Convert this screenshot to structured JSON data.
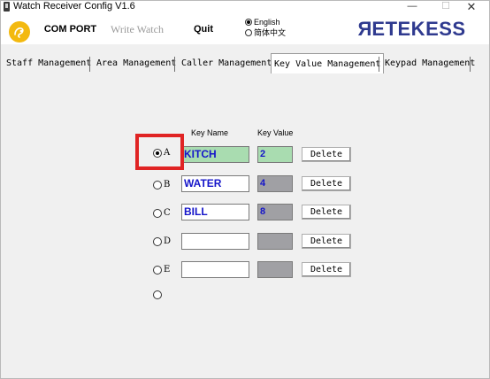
{
  "window": {
    "title": "Watch Receiver Config V1.6",
    "minimize_glyph": "—",
    "maximize_glyph": "☐",
    "close_glyph": "✕"
  },
  "toolbar": {
    "com_port_label": "COM PORT",
    "write_watch_label": "Write Watch",
    "quit_label": "Quit",
    "language": {
      "english_label": "English",
      "chinese_label": "简体中文",
      "selected": "English"
    },
    "brand_first": "R",
    "brand_rest": "ETEKESS"
  },
  "tabs": [
    {
      "label": "Staff Management",
      "active": false
    },
    {
      "label": "Area Management",
      "active": false
    },
    {
      "label": "Caller Management",
      "active": false
    },
    {
      "label": "Key Value Management",
      "active": true
    },
    {
      "label": "Keypad Management",
      "active": false
    }
  ],
  "key_table": {
    "header_name": "Key Name",
    "header_value": "Key Value",
    "rows": [
      {
        "letter": "A",
        "name": "KITCH",
        "value": "2",
        "selected": true,
        "delete_label": "Delete"
      },
      {
        "letter": "B",
        "name": "WATER",
        "value": "4",
        "selected": false,
        "delete_label": "Delete"
      },
      {
        "letter": "C",
        "name": "BILL",
        "value": "8",
        "selected": false,
        "delete_label": "Delete"
      },
      {
        "letter": "D",
        "name": "",
        "value": "",
        "selected": false,
        "delete_label": "Delete"
      },
      {
        "letter": "E",
        "name": "",
        "value": "",
        "selected": false,
        "delete_label": "Delete"
      }
    ]
  },
  "colors": {
    "brand": "#2f3a8f",
    "logo": "#f3b90f",
    "selected_field": "#a9dcb0",
    "empty_value": "#a0a0a4",
    "highlight": "#e02424",
    "field_text": "#1515c9"
  }
}
